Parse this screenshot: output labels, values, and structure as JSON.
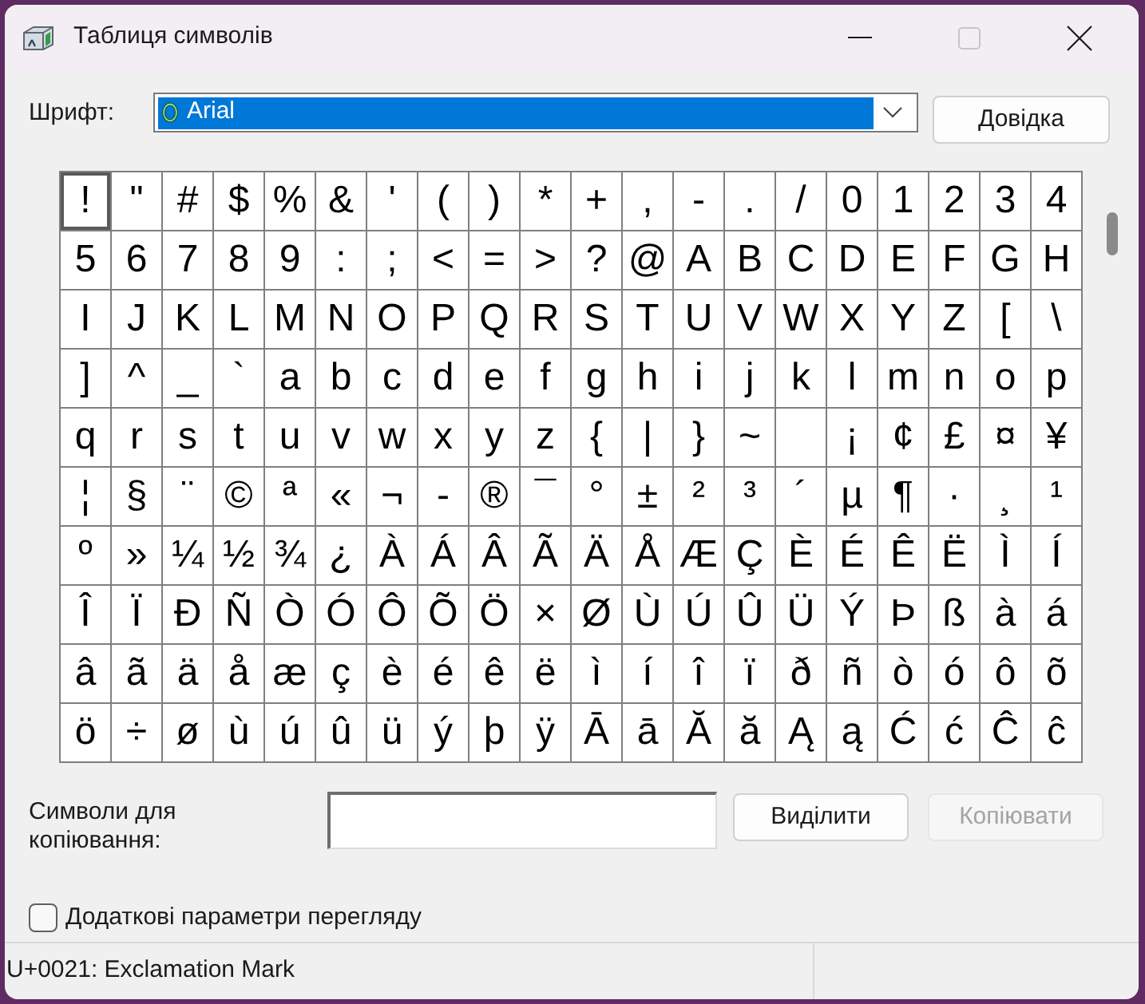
{
  "window": {
    "title": "Таблиця символів",
    "buttons": [
      {
        "kind": "minimize",
        "disabled": false
      },
      {
        "kind": "maximize",
        "disabled": true
      },
      {
        "kind": "close",
        "disabled": false
      }
    ]
  },
  "font": {
    "label": "Шрифт:",
    "value": "Arial",
    "selected": true
  },
  "help_button": {
    "label": "Довідка"
  },
  "character_grid": {
    "rows": [
      [
        {
          "char": "!",
          "selected": true
        },
        {
          "char": "\"",
          "selected": false
        },
        {
          "char": "#",
          "selected": false
        },
        {
          "char": "$",
          "selected": false
        },
        {
          "char": "%",
          "selected": false
        },
        {
          "char": "&",
          "selected": false
        },
        {
          "char": "'",
          "selected": false
        },
        {
          "char": "(",
          "selected": false
        },
        {
          "char": ")",
          "selected": false
        },
        {
          "char": "*",
          "selected": false
        },
        {
          "char": "+",
          "selected": false
        },
        {
          "char": ",",
          "selected": false
        },
        {
          "char": "-",
          "selected": false
        },
        {
          "char": ".",
          "selected": false
        },
        {
          "char": "/",
          "selected": false
        },
        {
          "char": "0",
          "selected": false
        },
        {
          "char": "1",
          "selected": false
        },
        {
          "char": "2",
          "selected": false
        },
        {
          "char": "3",
          "selected": false
        },
        {
          "char": "4",
          "selected": false
        }
      ],
      [
        {
          "char": "5",
          "selected": false
        },
        {
          "char": "6",
          "selected": false
        },
        {
          "char": "7",
          "selected": false
        },
        {
          "char": "8",
          "selected": false
        },
        {
          "char": "9",
          "selected": false
        },
        {
          "char": ":",
          "selected": false
        },
        {
          "char": ";",
          "selected": false
        },
        {
          "char": "<",
          "selected": false
        },
        {
          "char": "=",
          "selected": false
        },
        {
          "char": ">",
          "selected": false
        },
        {
          "char": "?",
          "selected": false
        },
        {
          "char": "@",
          "selected": false
        },
        {
          "char": "A",
          "selected": false
        },
        {
          "char": "B",
          "selected": false
        },
        {
          "char": "C",
          "selected": false
        },
        {
          "char": "D",
          "selected": false
        },
        {
          "char": "E",
          "selected": false
        },
        {
          "char": "F",
          "selected": false
        },
        {
          "char": "G",
          "selected": false
        },
        {
          "char": "H",
          "selected": false
        }
      ],
      [
        {
          "char": "I",
          "selected": false
        },
        {
          "char": "J",
          "selected": false
        },
        {
          "char": "K",
          "selected": false
        },
        {
          "char": "L",
          "selected": false
        },
        {
          "char": "M",
          "selected": false
        },
        {
          "char": "N",
          "selected": false
        },
        {
          "char": "O",
          "selected": false
        },
        {
          "char": "P",
          "selected": false
        },
        {
          "char": "Q",
          "selected": false
        },
        {
          "char": "R",
          "selected": false
        },
        {
          "char": "S",
          "selected": false
        },
        {
          "char": "T",
          "selected": false
        },
        {
          "char": "U",
          "selected": false
        },
        {
          "char": "V",
          "selected": false
        },
        {
          "char": "W",
          "selected": false
        },
        {
          "char": "X",
          "selected": false
        },
        {
          "char": "Y",
          "selected": false
        },
        {
          "char": "Z",
          "selected": false
        },
        {
          "char": "[",
          "selected": false
        },
        {
          "char": "\\",
          "selected": false
        }
      ],
      [
        {
          "char": "]",
          "selected": false
        },
        {
          "char": "^",
          "selected": false
        },
        {
          "char": "_",
          "selected": false
        },
        {
          "char": "`",
          "selected": false
        },
        {
          "char": "a",
          "selected": false
        },
        {
          "char": "b",
          "selected": false
        },
        {
          "char": "c",
          "selected": false
        },
        {
          "char": "d",
          "selected": false
        },
        {
          "char": "e",
          "selected": false
        },
        {
          "char": "f",
          "selected": false
        },
        {
          "char": "g",
          "selected": false
        },
        {
          "char": "h",
          "selected": false
        },
        {
          "char": "i",
          "selected": false
        },
        {
          "char": "j",
          "selected": false
        },
        {
          "char": "k",
          "selected": false
        },
        {
          "char": "l",
          "selected": false
        },
        {
          "char": "m",
          "selected": false
        },
        {
          "char": "n",
          "selected": false
        },
        {
          "char": "o",
          "selected": false
        },
        {
          "char": "p",
          "selected": false
        }
      ],
      [
        {
          "char": "q",
          "selected": false
        },
        {
          "char": "r",
          "selected": false
        },
        {
          "char": "s",
          "selected": false
        },
        {
          "char": "t",
          "selected": false
        },
        {
          "char": "u",
          "selected": false
        },
        {
          "char": "v",
          "selected": false
        },
        {
          "char": "w",
          "selected": false
        },
        {
          "char": "x",
          "selected": false
        },
        {
          "char": "y",
          "selected": false
        },
        {
          "char": "z",
          "selected": false
        },
        {
          "char": "{",
          "selected": false
        },
        {
          "char": "|",
          "selected": false
        },
        {
          "char": "}",
          "selected": false
        },
        {
          "char": "~",
          "selected": false
        },
        {
          "selected": false
        },
        {
          "char": "¡",
          "selected": false
        },
        {
          "char": "¢",
          "selected": false
        },
        {
          "char": "£",
          "selected": false
        },
        {
          "char": "¤",
          "selected": false
        },
        {
          "char": "¥",
          "selected": false
        }
      ],
      [
        {
          "char": "¦",
          "selected": false
        },
        {
          "char": "§",
          "selected": false
        },
        {
          "char": "¨",
          "selected": false
        },
        {
          "char": "©",
          "selected": false
        },
        {
          "char": "ª",
          "selected": false
        },
        {
          "char": "«",
          "selected": false
        },
        {
          "char": "¬",
          "selected": false
        },
        {
          "char": "-",
          "selected": false
        },
        {
          "char": "®",
          "selected": false
        },
        {
          "char": "¯",
          "selected": false
        },
        {
          "char": "°",
          "selected": false
        },
        {
          "char": "±",
          "selected": false
        },
        {
          "char": "²",
          "selected": false
        },
        {
          "char": "³",
          "selected": false
        },
        {
          "char": "´",
          "selected": false
        },
        {
          "char": "µ",
          "selected": false
        },
        {
          "char": "¶",
          "selected": false
        },
        {
          "char": "·",
          "selected": false
        },
        {
          "char": "¸",
          "selected": false
        },
        {
          "char": "¹",
          "selected": false
        }
      ],
      [
        {
          "char": "º",
          "selected": false
        },
        {
          "char": "»",
          "selected": false
        },
        {
          "char": "¼",
          "selected": false
        },
        {
          "char": "½",
          "selected": false
        },
        {
          "char": "¾",
          "selected": false
        },
        {
          "char": "¿",
          "selected": false
        },
        {
          "char": "À",
          "selected": false
        },
        {
          "char": "Á",
          "selected": false
        },
        {
          "char": "Â",
          "selected": false
        },
        {
          "char": "Ã",
          "selected": false
        },
        {
          "char": "Ä",
          "selected": false
        },
        {
          "char": "Å",
          "selected": false
        },
        {
          "char": "Æ",
          "selected": false
        },
        {
          "char": "Ç",
          "selected": false
        },
        {
          "char": "È",
          "selected": false
        },
        {
          "char": "É",
          "selected": false
        },
        {
          "char": "Ê",
          "selected": false
        },
        {
          "char": "Ë",
          "selected": false
        },
        {
          "char": "Ì",
          "selected": false
        },
        {
          "char": "Í",
          "selected": false
        }
      ],
      [
        {
          "char": "Î",
          "selected": false
        },
        {
          "char": "Ï",
          "selected": false
        },
        {
          "char": "Ð",
          "selected": false
        },
        {
          "char": "Ñ",
          "selected": false
        },
        {
          "char": "Ò",
          "selected": false
        },
        {
          "char": "Ó",
          "selected": false
        },
        {
          "char": "Ô",
          "selected": false
        },
        {
          "char": "Õ",
          "selected": false
        },
        {
          "char": "Ö",
          "selected": false
        },
        {
          "char": "×",
          "selected": false
        },
        {
          "char": "Ø",
          "selected": false
        },
        {
          "char": "Ù",
          "selected": false
        },
        {
          "char": "Ú",
          "selected": false
        },
        {
          "char": "Û",
          "selected": false
        },
        {
          "char": "Ü",
          "selected": false
        },
        {
          "char": "Ý",
          "selected": false
        },
        {
          "char": "Þ",
          "selected": false
        },
        {
          "char": "ß",
          "selected": false
        },
        {
          "char": "à",
          "selected": false
        },
        {
          "char": "á",
          "selected": false
        }
      ],
      [
        {
          "char": "â",
          "selected": false
        },
        {
          "char": "ã",
          "selected": false
        },
        {
          "char": "ä",
          "selected": false
        },
        {
          "char": "å",
          "selected": false
        },
        {
          "char": "æ",
          "selected": false
        },
        {
          "char": "ç",
          "selected": false
        },
        {
          "char": "è",
          "selected": false
        },
        {
          "char": "é",
          "selected": false
        },
        {
          "char": "ê",
          "selected": false
        },
        {
          "char": "ë",
          "selected": false
        },
        {
          "char": "ì",
          "selected": false
        },
        {
          "char": "í",
          "selected": false
        },
        {
          "char": "î",
          "selected": false
        },
        {
          "char": "ï",
          "selected": false
        },
        {
          "char": "ð",
          "selected": false
        },
        {
          "char": "ñ",
          "selected": false
        },
        {
          "char": "ò",
          "selected": false
        },
        {
          "char": "ó",
          "selected": false
        },
        {
          "char": "ô",
          "selected": false
        },
        {
          "char": "õ",
          "selected": false
        }
      ],
      [
        {
          "char": "ö",
          "selected": false
        },
        {
          "char": "÷",
          "selected": false
        },
        {
          "char": "ø",
          "selected": false
        },
        {
          "char": "ù",
          "selected": false
        },
        {
          "char": "ú",
          "selected": false
        },
        {
          "char": "û",
          "selected": false
        },
        {
          "char": "ü",
          "selected": false
        },
        {
          "char": "ý",
          "selected": false
        },
        {
          "char": "þ",
          "selected": false
        },
        {
          "char": "ÿ",
          "selected": false
        },
        {
          "char": "Ā",
          "selected": false
        },
        {
          "char": "ā",
          "selected": false
        },
        {
          "char": "Ă",
          "selected": false
        },
        {
          "char": "ă",
          "selected": false
        },
        {
          "char": "Ą",
          "selected": false
        },
        {
          "char": "ą",
          "selected": false
        },
        {
          "char": "Ć",
          "selected": false
        },
        {
          "char": "ć",
          "selected": false
        },
        {
          "char": "Ĉ",
          "selected": false
        },
        {
          "char": "ĉ",
          "selected": false
        }
      ]
    ]
  },
  "copy": {
    "label": "Символи для копіювання:",
    "buttons": [
      {
        "label": "Виділити",
        "disabled": false
      },
      {
        "label": "Копіювати",
        "disabled": true
      }
    ]
  },
  "advanced_view": {
    "label": "Додаткові параметри перегляду",
    "checked": false
  },
  "status_bar": {
    "text": "U+0021: Exclamation Mark"
  }
}
